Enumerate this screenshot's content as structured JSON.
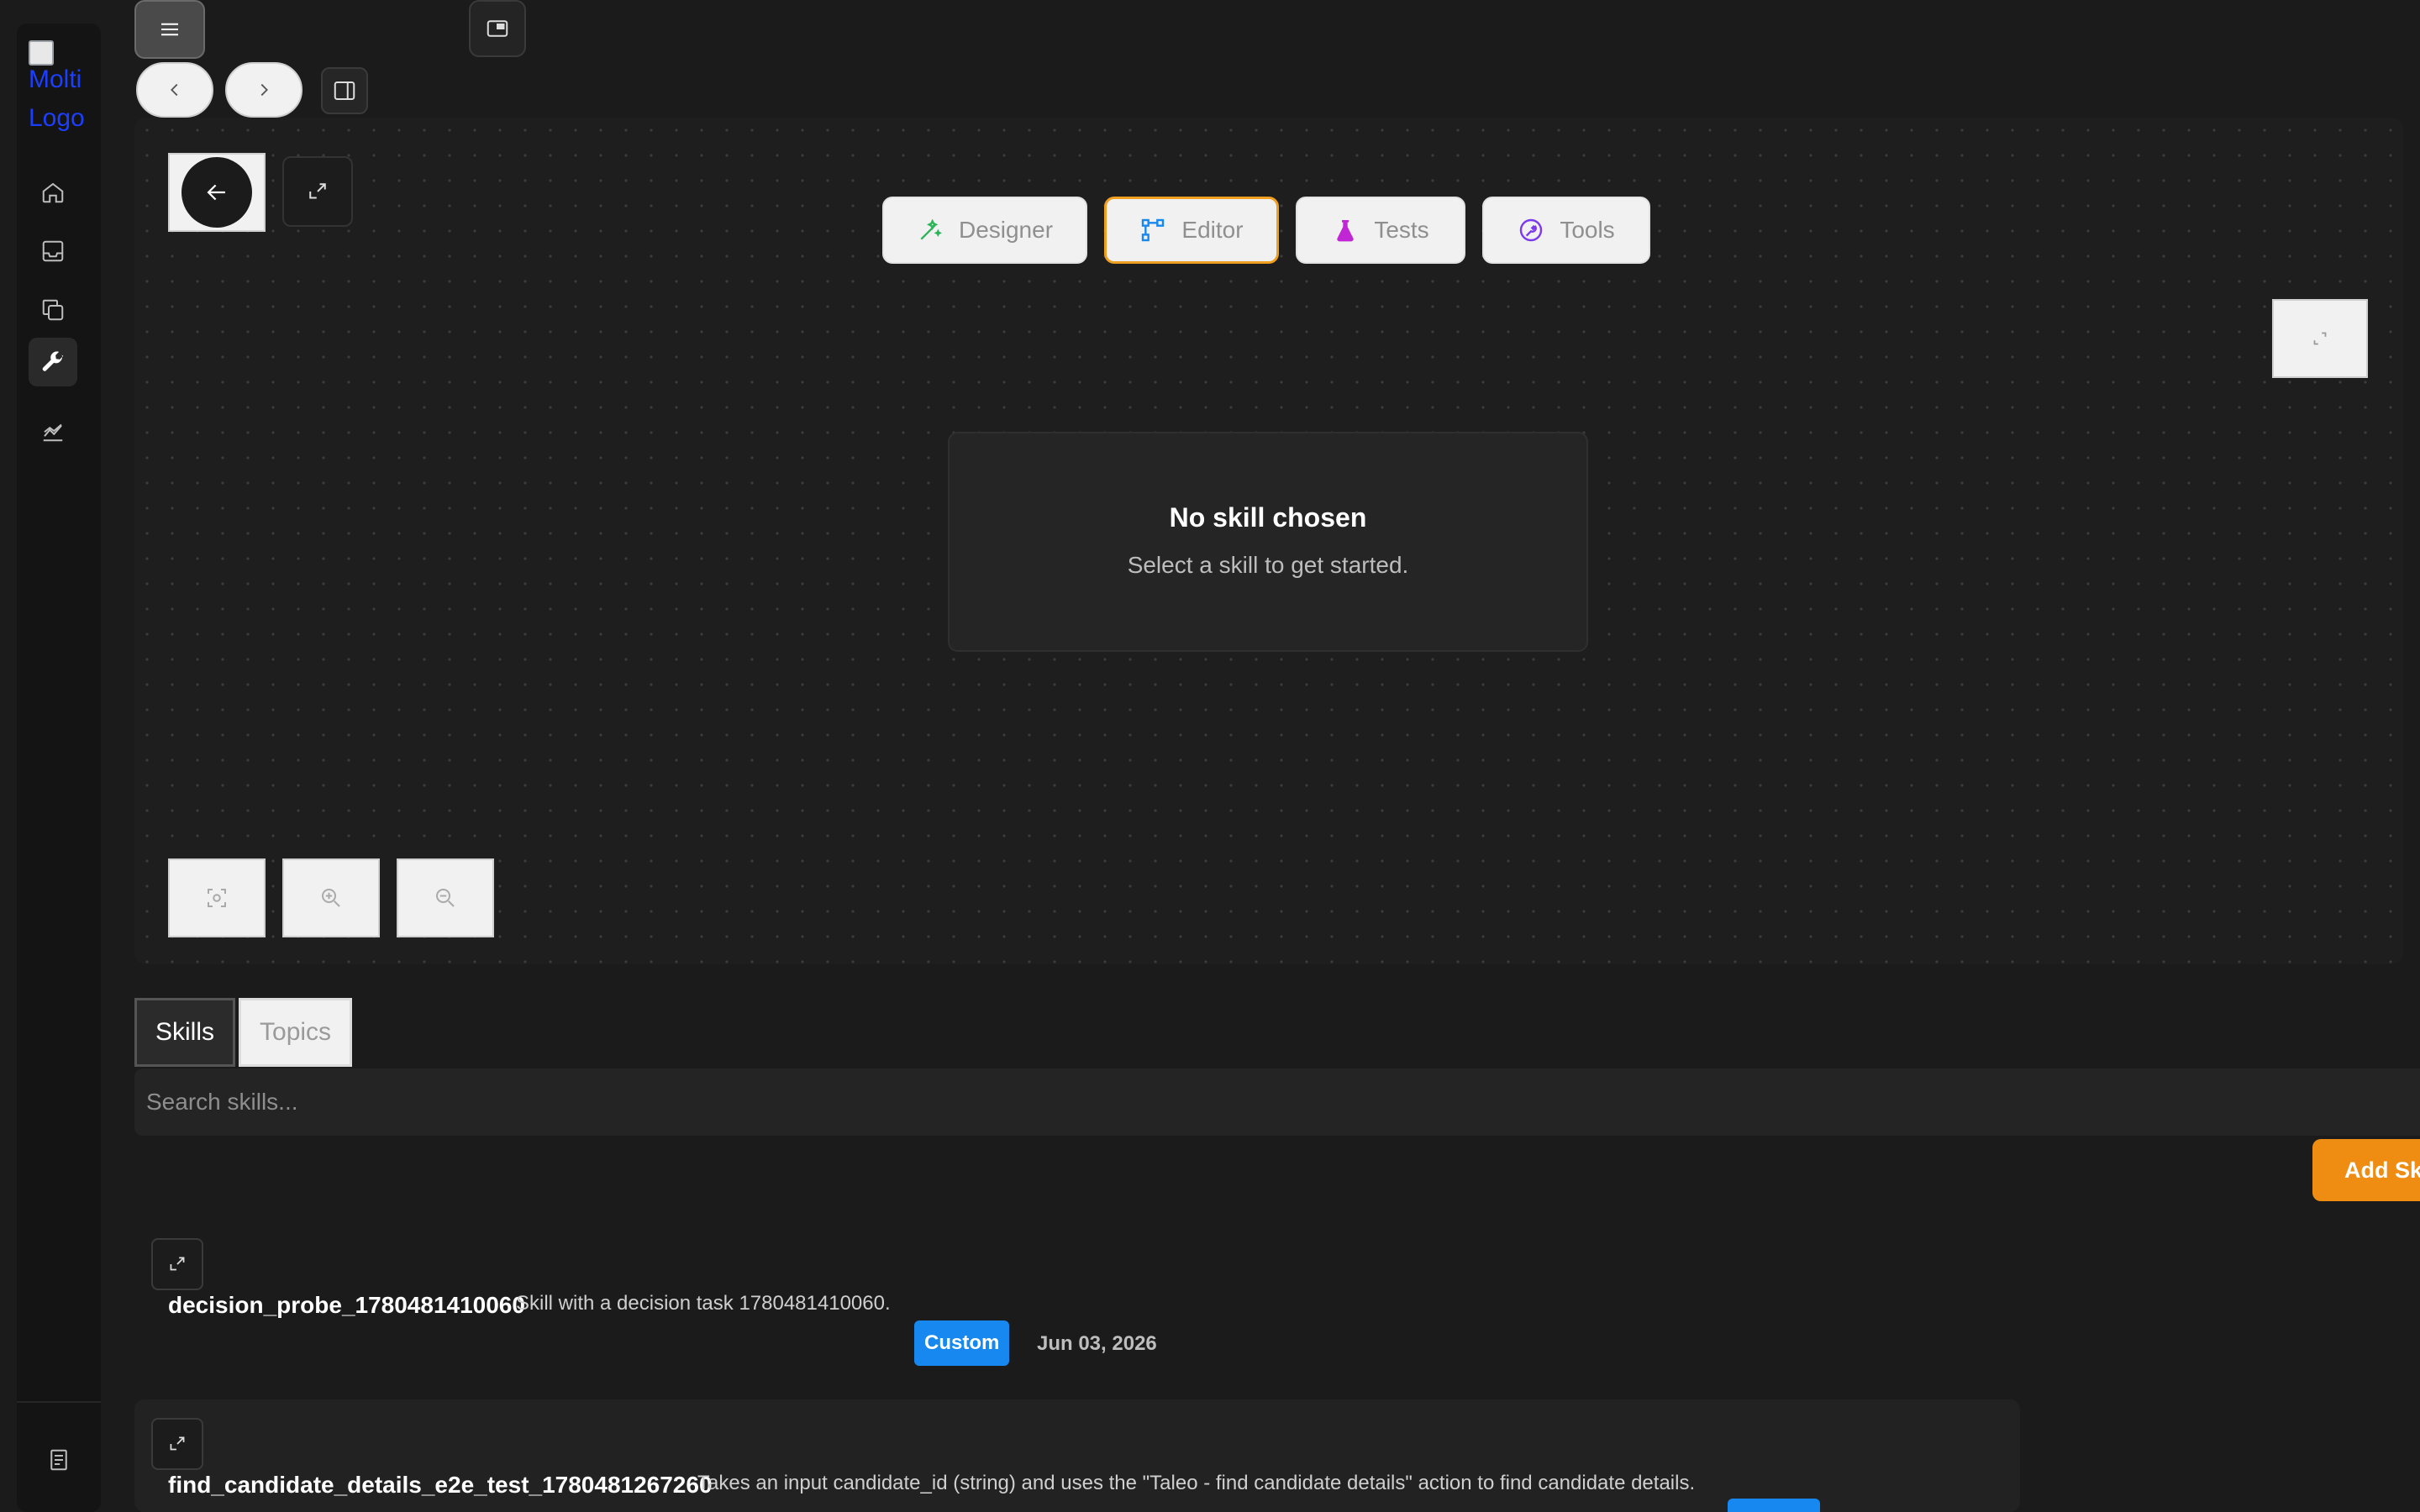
{
  "sidebar": {
    "logo_alt": "Moveworks Logo",
    "logo_line1": "Molti",
    "logo_line2": "Logo",
    "items": [
      {
        "icon": "home-icon"
      },
      {
        "icon": "inbox-icon"
      },
      {
        "icon": "copy-icon"
      },
      {
        "icon": "wrench-icon",
        "active": true
      },
      {
        "icon": "chart-icon"
      }
    ],
    "bottom_icon": "document-icon"
  },
  "modes": [
    {
      "label": "Designer",
      "icon": "wand-icon",
      "color": "#2fb35a"
    },
    {
      "label": "Editor",
      "icon": "hierarchy-icon",
      "color": "#1688f0",
      "active": true
    },
    {
      "label": "Tests",
      "icon": "flask-icon",
      "color": "#c026d3"
    },
    {
      "label": "Tools",
      "icon": "tool-circle-icon",
      "color": "#7c3aed"
    }
  ],
  "empty_state": {
    "title": "No skill chosen",
    "subtitle": "Select a skill to get started."
  },
  "tabs": [
    {
      "label": "Skills",
      "active": true
    },
    {
      "label": "Topics",
      "active": false
    }
  ],
  "search": {
    "placeholder": "Search skills..."
  },
  "add_button": "Add Sk",
  "skills": [
    {
      "name": "decision_probe_1780481410060",
      "description": "Skill with a decision task 1780481410060.",
      "badge": "Custom",
      "date": "Jun 03, 2026"
    },
    {
      "name": "find_candidate_details_e2e_test_1780481267260",
      "description": "Takes an input candidate_id (string) and uses the \"Taleo - find candidate details\" action to find candidate details."
    }
  ],
  "colors": {
    "accent_orange": "#ef8c12",
    "badge_blue": "#1688f0",
    "background": "#1b1b1b"
  }
}
